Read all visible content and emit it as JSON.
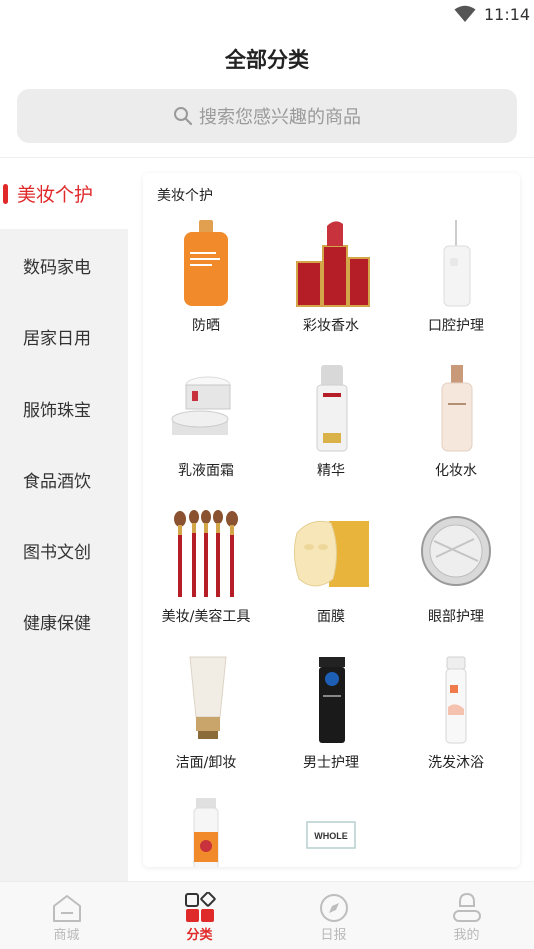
{
  "status_bar": {
    "time": "11:14"
  },
  "header": {
    "title": "全部分类"
  },
  "search": {
    "placeholder": "搜索您感兴趣的商品"
  },
  "sidebar": {
    "items": [
      {
        "label": "美妆个护",
        "active": true
      },
      {
        "label": "数码家电"
      },
      {
        "label": "居家日用"
      },
      {
        "label": "服饰珠宝"
      },
      {
        "label": "食品酒饮"
      },
      {
        "label": "图书文创"
      },
      {
        "label": "健康保健"
      }
    ]
  },
  "panel": {
    "title": "美妆个护",
    "items": [
      {
        "label": "防晒",
        "icon": "sunscreen-bottle-icon"
      },
      {
        "label": "彩妆香水",
        "icon": "lipstick-icon"
      },
      {
        "label": "口腔护理",
        "icon": "oral-irrigator-icon"
      },
      {
        "label": "乳液面霜",
        "icon": "cream-jar-icon"
      },
      {
        "label": "精华",
        "icon": "serum-bottle-icon"
      },
      {
        "label": "化妆水",
        "icon": "toner-bottle-icon"
      },
      {
        "label": "美妆/美容工具",
        "icon": "makeup-brushes-icon"
      },
      {
        "label": "面膜",
        "icon": "face-mask-icon"
      },
      {
        "label": "眼部护理",
        "icon": "eye-cream-jar-icon"
      },
      {
        "label": "洁面/卸妆",
        "icon": "cleanser-tube-icon"
      },
      {
        "label": "男士护理",
        "icon": "mens-care-bottle-icon"
      },
      {
        "label": "洗发沐浴",
        "icon": "shampoo-bottle-icon"
      },
      {
        "label": "",
        "icon": "pump-bottle-icon"
      },
      {
        "label": "",
        "icon": "whole-brand-logo",
        "logo_text": "WHOLE"
      }
    ]
  },
  "tabbar": {
    "tabs": [
      {
        "label": "商城",
        "icon": "home-icon"
      },
      {
        "label": "分类",
        "icon": "category-icon",
        "active": true
      },
      {
        "label": "日报",
        "icon": "compass-icon"
      },
      {
        "label": "我的",
        "icon": "person-icon"
      }
    ]
  },
  "colors": {
    "accent": "#e02a2a",
    "sidebar_bg": "#f2f2f2",
    "search_bg": "#ececec"
  }
}
